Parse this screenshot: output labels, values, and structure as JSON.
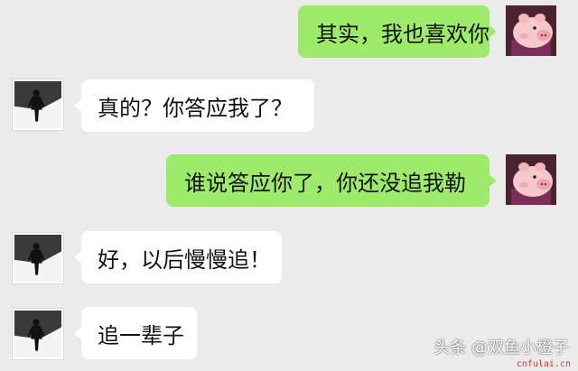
{
  "messages": [
    {
      "sender": "me",
      "text": "其实，我也喜欢你"
    },
    {
      "sender": "other",
      "text": "真的？你答应我了？"
    },
    {
      "sender": "me",
      "text": "谁说答应你了，你还没追我勒"
    },
    {
      "sender": "other",
      "text": "好，以后慢慢追！"
    },
    {
      "sender": "other",
      "text": "追一辈子"
    }
  ],
  "avatars": {
    "me": "pig-avatar-icon",
    "other": "person-avatar-icon"
  },
  "colors": {
    "background": "#ebebeb",
    "my_bubble": "#9eea6a",
    "their_bubble": "#ffffff"
  },
  "watermark": {
    "text": "头条 @双鱼小橙子",
    "site": "cnfulai.cn"
  }
}
